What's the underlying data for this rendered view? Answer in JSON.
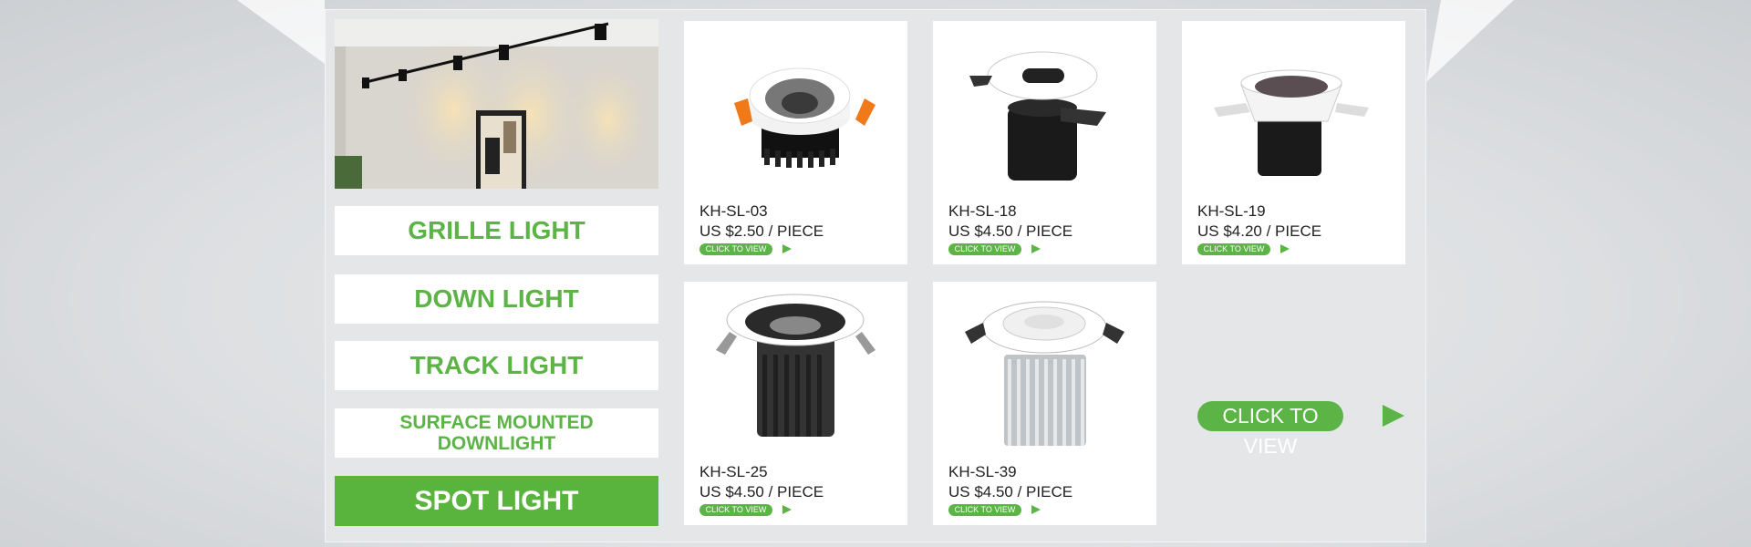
{
  "colors": {
    "accent": "#5bb445",
    "accent_active": "#58b43d",
    "card_bg": "#ffffff"
  },
  "hero": {
    "image": "track-lights-on-wall-photo"
  },
  "categories": [
    {
      "label": "GRILLE LIGHT",
      "active": false
    },
    {
      "label": "DOWN LIGHT",
      "active": false
    },
    {
      "label": "TRACK LIGHT",
      "active": false
    },
    {
      "label_line1": "SURFACE MOUNTED",
      "label_line2": "DOWNLIGHT",
      "active": false
    },
    {
      "label": "SPOT LIGHT",
      "active": true
    }
  ],
  "products": [
    {
      "code": "KH-SL-03",
      "price": "US $2.50 / PIECE",
      "button": "CLICK TO VIEW",
      "icon": "recessed-spotlight-orange-clips-icon"
    },
    {
      "code": "KH-SL-18",
      "price": "US $4.50 / PIECE",
      "button": "CLICK TO VIEW",
      "icon": "wall-washer-spotlight-icon"
    },
    {
      "code": "KH-SL-19",
      "price": "US $4.20 / PIECE",
      "button": "CLICK TO VIEW",
      "icon": "trimless-spotlight-icon"
    },
    {
      "code": "KH-SL-25",
      "price": "US $4.50 / PIECE",
      "button": "CLICK TO VIEW",
      "icon": "black-heatsink-spotlight-icon"
    },
    {
      "code": "KH-SL-39",
      "price": "US $4.50 / PIECE",
      "button": "CLICK TO VIEW",
      "icon": "silver-heatsink-spotlight-icon"
    }
  ],
  "view_all": {
    "label": "CLICK TO VIEW"
  }
}
